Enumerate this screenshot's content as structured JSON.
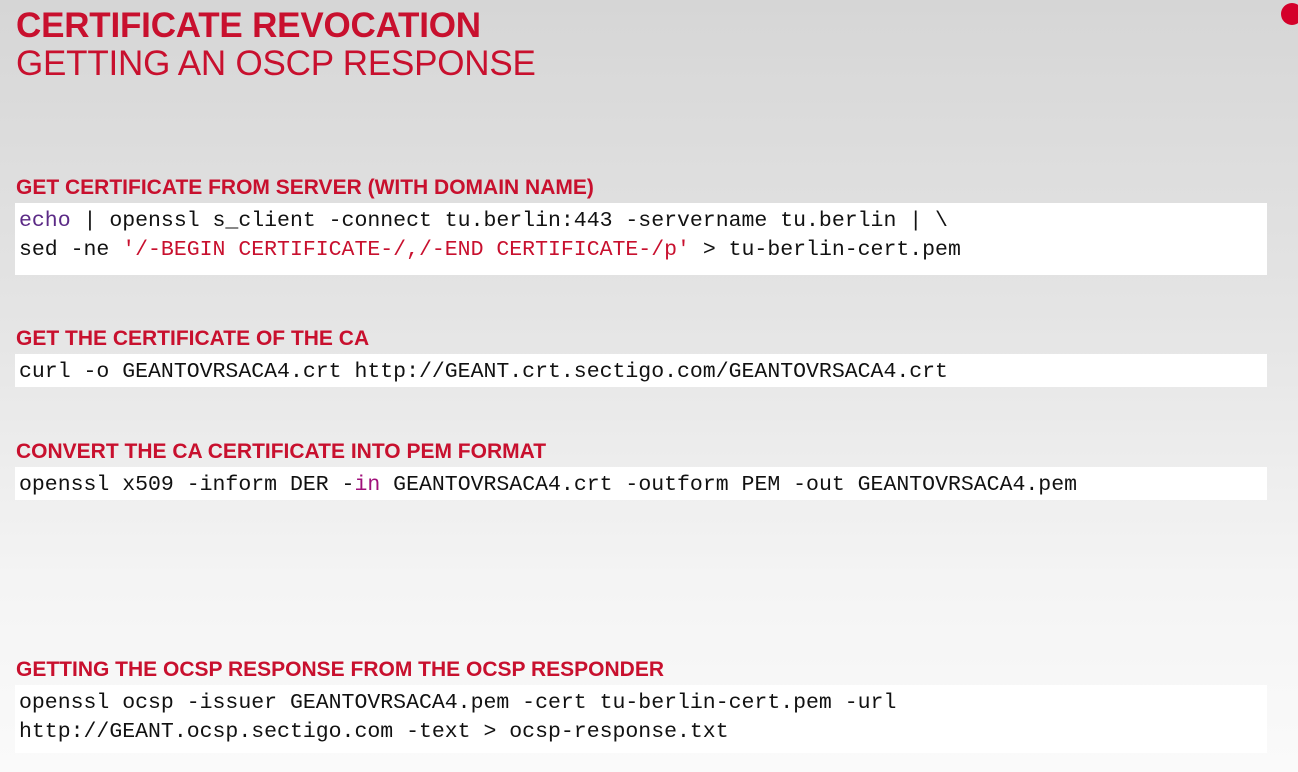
{
  "slide": {
    "title": "CERTIFICATE REVOCATION",
    "subtitle": "GETTING AN OSCP RESPONSE",
    "accent_color": "#c8102e"
  },
  "sections": [
    {
      "heading": "GET CERTIFICATE FROM SERVER (WITH DOMAIN NAME)",
      "code": {
        "line1_keyword": "echo",
        "line1_rest": " | openssl s_client -connect tu.berlin:443 -servername tu.berlin | \\",
        "line2_start": "sed -ne ",
        "line2_string": "'/-BEGIN CERTIFICATE-/,/-END CERTIFICATE-/p'",
        "line2_end": " > tu-berlin-cert.pem"
      }
    },
    {
      "heading": "GET THE CERTIFICATE OF THE CA",
      "code": {
        "line1": "curl -o GEANTOVRSACA4.crt http://GEANT.crt.sectigo.com/GEANTOVRSACA4.crt"
      }
    },
    {
      "heading": "CONVERT THE CA CERTIFICATE INTO PEM FORMAT",
      "code": {
        "line1_start": "openssl x509 -inform DER -",
        "line1_keyword": "in",
        "line1_end": " GEANTOVRSACA4.crt -outform PEM -out GEANTOVRSACA4.pem"
      }
    },
    {
      "heading": "GETTING THE OCSP RESPONSE FROM THE OCSP RESPONDER",
      "code": {
        "line1": "openssl ocsp -issuer GEANTOVRSACA4.pem -cert tu-berlin-cert.pem -url",
        "line2": "http://GEANT.ocsp.sectigo.com -text > ocsp-response.txt"
      }
    }
  ]
}
